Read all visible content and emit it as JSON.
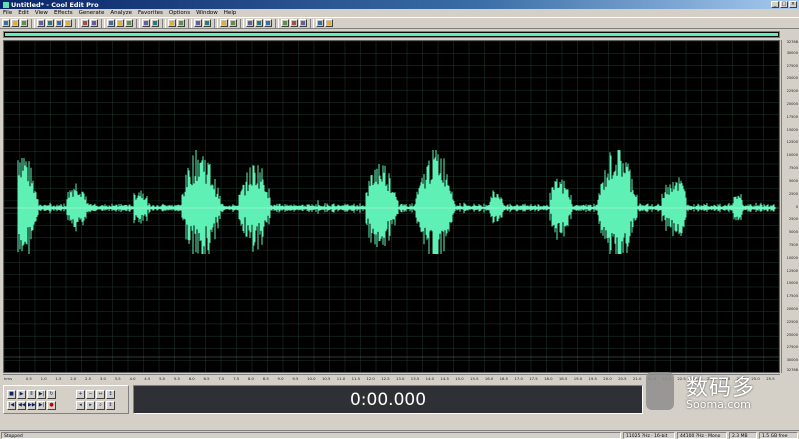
{
  "window": {
    "title": "Untitled* - Cool Edit Pro"
  },
  "menu": [
    "File",
    "Edit",
    "View",
    "Effects",
    "Generate",
    "Analyze",
    "Favorites",
    "Options",
    "Window",
    "Help"
  ],
  "toolbar": {
    "icons": [
      "new-icon",
      "open-icon",
      "save-icon",
      "sep",
      "cut-icon",
      "copy-icon",
      "paste-icon",
      "mix-paste-icon",
      "sep",
      "undo-icon",
      "redo-icon",
      "sep",
      "select-icon",
      "zoom-icon",
      "spectral-icon",
      "sep",
      "wave-icon",
      "multitrack-icon",
      "sep",
      "play-icon",
      "loop-icon",
      "sep",
      "marker-icon",
      "cue-icon",
      "sep",
      "settings-icon",
      "help-icon",
      "sep",
      "fx-icon",
      "eq-icon",
      "noise-icon",
      "sep",
      "script-icon",
      "batch-icon",
      "cd-icon",
      "sep",
      "info-icon",
      "about-icon"
    ]
  },
  "waveform": {
    "color": "#5ff0b5",
    "background": "#000000",
    "grid_color": "#1f3a2c",
    "center_line_color": "#ffffff"
  },
  "amplitude_ruler": {
    "labels": [
      "32768",
      "30000",
      "27500",
      "25000",
      "22500",
      "20000",
      "17500",
      "15000",
      "12500",
      "10000",
      "7500",
      "5000",
      "2500",
      "0",
      "2500",
      "5000",
      "7500",
      "10000",
      "12500",
      "15000",
      "17500",
      "20000",
      "22500",
      "25000",
      "27500",
      "30000",
      "32768"
    ]
  },
  "time_ruler": {
    "unit": "hms",
    "labels": [
      "0.5",
      "1.0",
      "1.5",
      "2.0",
      "2.5",
      "3.0",
      "3.5",
      "4.0",
      "4.5",
      "5.0",
      "5.5",
      "6.0",
      "6.5",
      "7.0",
      "7.5",
      "8.0",
      "8.5",
      "9.0",
      "9.5",
      "10.0",
      "10.5",
      "11.0",
      "11.5",
      "12.0",
      "12.5",
      "13.0",
      "13.5",
      "14.0",
      "14.5",
      "15.0",
      "15.5",
      "16.0",
      "16.5",
      "17.0",
      "17.5",
      "18.0",
      "18.5",
      "19.0",
      "19.5",
      "20.0",
      "20.5",
      "21.0",
      "21.5",
      "22.0",
      "22.5",
      "23.0",
      "23.5",
      "24.0",
      "24.5",
      "25.0",
      "25.5"
    ]
  },
  "transport": {
    "row1": [
      "stop-icon",
      "play-icon",
      "pause-icon",
      "play-to-end-icon",
      "loop-icon"
    ],
    "row2": [
      "rewind-to-start-icon",
      "rewind-icon",
      "fast-forward-icon",
      "forward-to-end-icon",
      "record-icon"
    ],
    "zoom_row1": [
      "zoom-in-icon",
      "zoom-out-icon",
      "zoom-full-icon",
      "zoom-vertical-in-icon"
    ],
    "zoom_row2": [
      "zoom-left-icon",
      "zoom-right-icon",
      "zoom-selection-icon",
      "zoom-vertical-out-icon"
    ]
  },
  "time_display": {
    "value": "0:00.000"
  },
  "watermark": {
    "title": "数码多",
    "domain": "Sooma.com"
  },
  "status": {
    "state": "Stopped",
    "sample_rate": "11025 ?Hz · 16-bit",
    "format": "44100 ?Hz · Mono",
    "size": "2.3 MB",
    "free": "1.5 GB free"
  }
}
